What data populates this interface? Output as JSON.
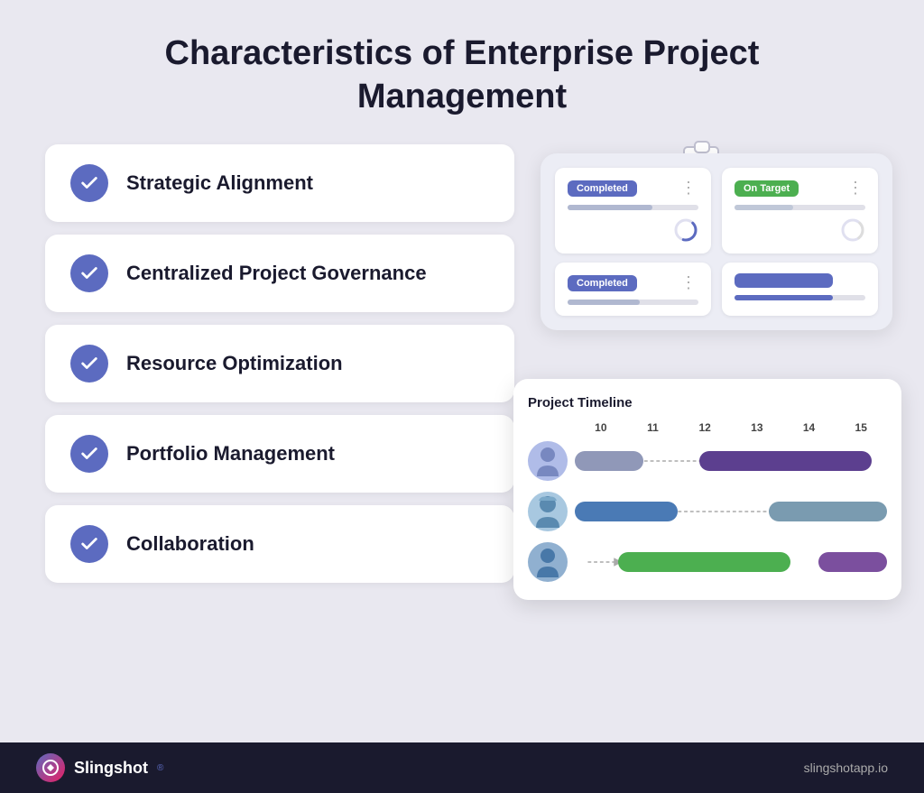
{
  "page": {
    "background_color": "#e9e8f0",
    "title": "Characteristics of Enterprise Project Management"
  },
  "list_items": [
    {
      "id": 1,
      "label": "Strategic Alignment"
    },
    {
      "id": 2,
      "label": "Centralized Project Governance"
    },
    {
      "id": 3,
      "label": "Resource Optimization"
    },
    {
      "id": 4,
      "label": "Portfolio Management"
    },
    {
      "id": 5,
      "label": "Collaboration"
    }
  ],
  "status_cards": [
    {
      "badge": "Completed",
      "badge_type": "completed",
      "progress": 60
    },
    {
      "badge": "On Target",
      "badge_type": "ontarget",
      "progress": 40
    }
  ],
  "status_cards_row2": [
    {
      "badge": "Completed",
      "badge_type": "completed",
      "progress": 50
    },
    {
      "badge": "",
      "badge_type": "blue",
      "progress": 80
    }
  ],
  "timeline": {
    "title": "Project Timeline",
    "columns": [
      "10",
      "11",
      "12",
      "13",
      "14",
      "15"
    ],
    "rows": [
      {
        "avatar_color": "#b0bce8",
        "avatar_emoji": "🧑",
        "bars": [
          {
            "left_pct": 0,
            "width_pct": 22,
            "color": "#9098b8"
          },
          {
            "left_pct": 38,
            "width_pct": 50,
            "color": "#5c3f8f"
          }
        ],
        "arrow_start_pct": 22,
        "arrow_end_pct": 88
      },
      {
        "avatar_color": "#a0c8e0",
        "avatar_emoji": "👩",
        "bars": [
          {
            "left_pct": 0,
            "width_pct": 35,
            "color": "#4a7ab5"
          }
        ],
        "arrow_start_pct": 35,
        "arrow_end_pct": 100,
        "second_bar": {
          "left_pct": 60,
          "width_pct": 40,
          "color": "#7a9bb0"
        }
      },
      {
        "avatar_color": "#90b0d0",
        "avatar_emoji": "🧑",
        "bars": [
          {
            "left_pct": 5,
            "width_pct": 60,
            "color": "#4caf50"
          }
        ],
        "second_bar": {
          "left_pct": 80,
          "width_pct": 20,
          "color": "#7b4f9e"
        }
      }
    ]
  },
  "footer": {
    "logo_text": "Slingshot",
    "url": "slingshotapp.io"
  }
}
